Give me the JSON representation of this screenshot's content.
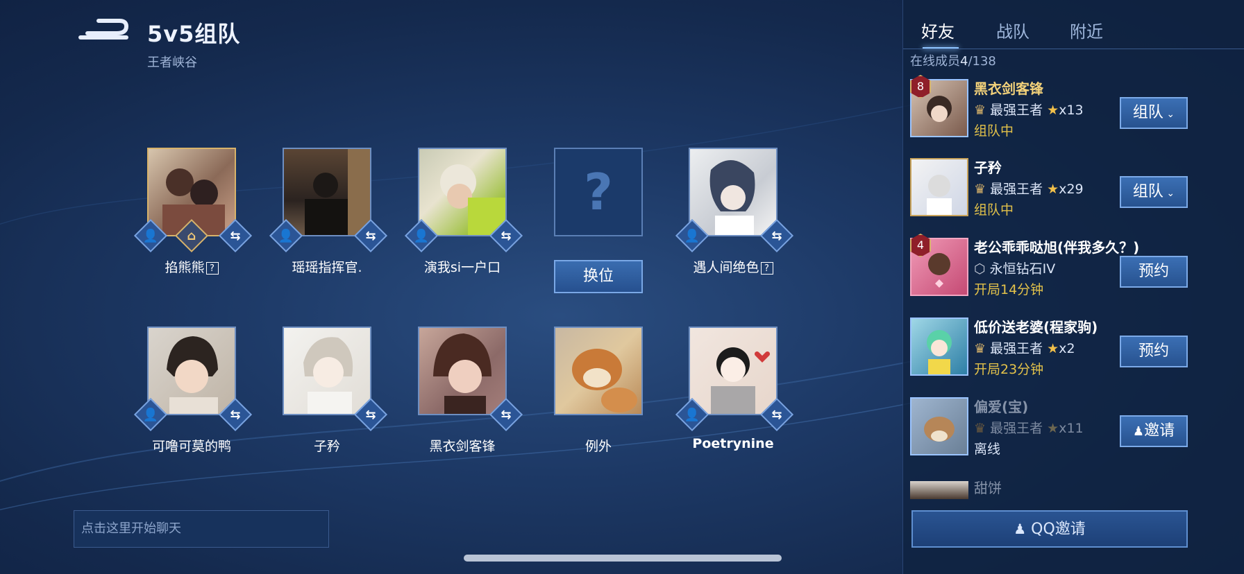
{
  "header": {
    "title": "5v5组队",
    "subtitle": "王者峡谷"
  },
  "team": {
    "row1": [
      {
        "name": "掐熊熊",
        "has_question": true,
        "icons": [
          "add-friend-icon",
          "home-icon",
          "swap-icon"
        ]
      },
      {
        "name": "瑶瑶指挥官.",
        "has_question": false,
        "icons": [
          "add-friend-icon",
          "swap-icon"
        ]
      },
      {
        "name": "演我si一户口",
        "has_question": false,
        "icons": [
          "add-friend-icon",
          "swap-icon"
        ]
      },
      {
        "name": "",
        "empty": true,
        "question_mark": "?",
        "button_label": "换位"
      },
      {
        "name": "遇人间绝色",
        "has_question": true,
        "icons": [
          "add-friend-icon",
          "swap-icon"
        ]
      }
    ],
    "row2": [
      {
        "name": "可噜可莫的鸭",
        "icons": [
          "add-friend-icon",
          "swap-icon"
        ]
      },
      {
        "name": "子矜",
        "icons": [
          "swap-icon"
        ]
      },
      {
        "name": "黑衣剑客锋",
        "icons": [
          "swap-icon"
        ]
      },
      {
        "name": "例外",
        "icons": []
      },
      {
        "name": "Poetrynine",
        "icons": [
          "add-friend-icon",
          "swap-icon"
        ]
      }
    ],
    "question_glyph": "?"
  },
  "chat": {
    "placeholder": "点击这里开始聊天"
  },
  "panel": {
    "tabs": [
      "好友",
      "战队",
      "附近"
    ],
    "active_tab": "好友",
    "online_label": "在线成员",
    "online_count": "4",
    "online_total": "/138",
    "friends": [
      {
        "name": "黑衣剑客锋",
        "badge": "8",
        "rank": "最强王者",
        "stars": "x13",
        "status": "组队中",
        "button": "组队",
        "button_dropdown": true
      },
      {
        "name": "子矜",
        "badge": "",
        "rank": "最强王者",
        "stars": "x29",
        "status": "组队中",
        "button": "组队",
        "button_dropdown": true
      },
      {
        "name": "老公乖乖哒旭(伴我多久？)",
        "badge": "4",
        "rank": "永恒钻石IV",
        "stars": "",
        "status": "开局14分钟",
        "button": "预约"
      },
      {
        "name": "低价送老婆(程家驹)",
        "badge": "",
        "rank": "最强王者",
        "stars": "x2",
        "status": "开局23分钟",
        "button": "预约"
      },
      {
        "name": "偏爱(宝)",
        "badge": "",
        "rank": "最强王者",
        "stars": "x11",
        "status": "离线",
        "button": "邀请",
        "offline": true
      },
      {
        "name": "甜饼",
        "partial": true
      }
    ],
    "qq_invite_label": "QQ邀请"
  },
  "colors": {
    "accent": "#7aa8e6",
    "gold": "#f2d17a",
    "status_yellow": "#e3c24a",
    "background": "#1d3966"
  }
}
